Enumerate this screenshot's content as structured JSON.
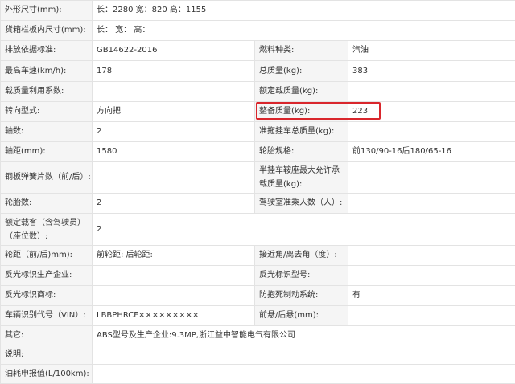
{
  "highlight_color": "#d9262c",
  "rows": [
    {
      "l1": "外形尺寸(mm):",
      "v1": "长：2280 宽：820 高：1155",
      "l2": null,
      "v2": null
    },
    {
      "l1": "货箱栏板内尺寸(mm):",
      "v1": "长： 宽： 高：",
      "l2": null,
      "v2": null
    },
    {
      "l1": "排放依据标准:",
      "v1": "GB14622-2016",
      "l2": "燃料种类:",
      "v2": "汽油"
    },
    {
      "l1": "最高车速(km/h):",
      "v1": "178",
      "l2": "总质量(kg):",
      "v2": "383"
    },
    {
      "l1": "载质量利用系数:",
      "v1": "",
      "l2": "额定载质量(kg):",
      "v2": ""
    },
    {
      "l1": "转向型式:",
      "v1": "方向把",
      "l2": "整备质量(kg):",
      "v2": "223"
    },
    {
      "l1": "轴数:",
      "v1": "2",
      "l2": "准拖挂车总质量(kg):",
      "v2": ""
    },
    {
      "l1": "轴距(mm):",
      "v1": "1580",
      "l2": "轮胎规格:",
      "v2": "前130/90-16后180/65-16"
    },
    {
      "l1": "钢板弹簧片数（前/后）:",
      "v1": "",
      "l2": "半挂车鞍座最大允许承载质量(kg):",
      "v2": ""
    },
    {
      "l1": "轮胎数:",
      "v1": "2",
      "l2": "驾驶室准乘人数（人）:",
      "v2": ""
    },
    {
      "l1": "额定载客（含驾驶员）（座位数）:",
      "v1": "2",
      "l2": null,
      "v2": null
    },
    {
      "l1": "轮距（前/后)mm):",
      "v1": "前轮距: 后轮距:",
      "l2": "接近角/离去角（度）:",
      "v2": ""
    },
    {
      "l1": "反光标识生产企业:",
      "v1": "",
      "l2": "反光标识型号:",
      "v2": ""
    },
    {
      "l1": "反光标识商标:",
      "v1": "",
      "l2": "防抱死制动系统:",
      "v2": "有"
    },
    {
      "l1": "车辆识别代号（VIN）:",
      "v1": "LBBPHRCF×××××××××",
      "l2": "前悬/后悬(mm):",
      "v2": ""
    },
    {
      "l1": "其它:",
      "v1": "ABS型号及生产企业:9.3MP,浙江益中智能电气有限公司",
      "l2": null,
      "v2": null
    },
    {
      "l1": "说明:",
      "v1": "",
      "l2": null,
      "v2": null
    },
    {
      "l1": "油耗申报值(L/100km):",
      "v1": "",
      "l2": null,
      "v2": null
    }
  ]
}
